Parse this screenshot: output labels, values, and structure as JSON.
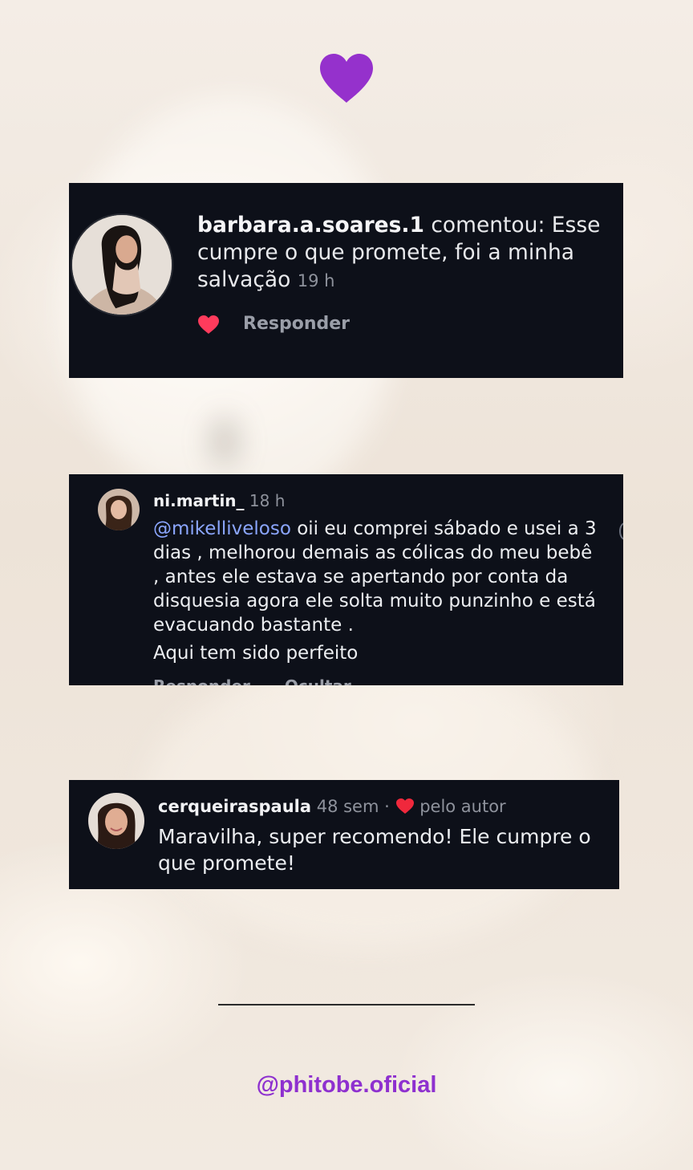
{
  "colors": {
    "card_bg": "#0d1019",
    "accent_purple": "#8e30cf",
    "like_red": "#ff3b5c",
    "mention_blue": "#8ba6ff"
  },
  "top_icon": "purple-heart-icon",
  "comments": [
    {
      "username": "barbara.a.soares.1",
      "text": " comentou: Esse cumpre o que promete, foi a minha salvação ",
      "time": "19 h",
      "reply_label": "Responder",
      "liked": true
    },
    {
      "username": "ni.martin_",
      "time": "18 h",
      "mention": "@mikelliveloso",
      "text": " oii eu comprei sábado e usei a 3 dias , melhorou demais as cólicas do meu bebê , antes ele estava se apertando por conta da disquesia agora ele solta muito punzinho e está evacuando bastante .",
      "extra_line": "Aqui tem sido perfeito",
      "actions": [
        "Responder",
        "Ocultar"
      ]
    },
    {
      "username": "cerqueiraspaula",
      "time": "48 sem",
      "separator": "·",
      "author_like_label": "pelo autor",
      "text": "Maravilha, super recomendo! Ele cumpre o que promete!"
    }
  ],
  "footer": {
    "handle": "@phitobe.oficial"
  }
}
